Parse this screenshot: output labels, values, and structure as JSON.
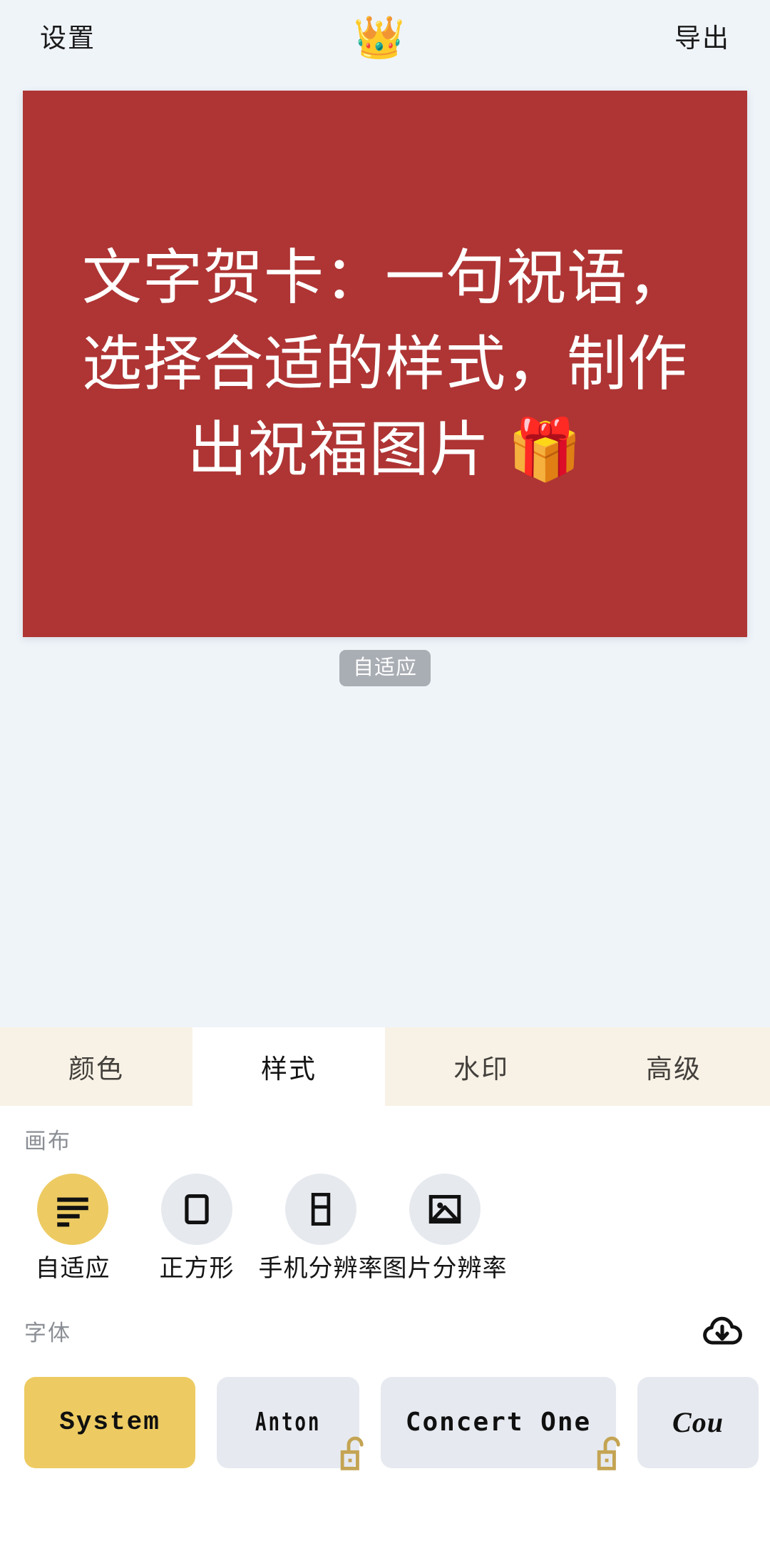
{
  "topbar": {
    "settings_label": "设置",
    "logo_icon": "crown-icon",
    "logo_glyph": "👑",
    "export_label": "导出"
  },
  "canvas": {
    "background_color": "#ae3534",
    "text_color": "#ffffff",
    "text": "文字贺卡：一句祝语，选择合适的样式，制作出祝福图片 🎁",
    "ratio_badge": "自适应"
  },
  "tabs": [
    {
      "label": "颜色",
      "active": false
    },
    {
      "label": "样式",
      "active": true
    },
    {
      "label": "水印",
      "active": false
    },
    {
      "label": "高级",
      "active": false
    }
  ],
  "canvas_section": {
    "label": "画布",
    "options": [
      {
        "label": "自适应",
        "icon": "align-left-icon",
        "selected": true
      },
      {
        "label": "正方形",
        "icon": "square-icon",
        "selected": false
      },
      {
        "label": "手机分辨率",
        "icon": "phone-icon",
        "selected": false
      },
      {
        "label": "图片分辨率",
        "icon": "image-icon",
        "selected": false
      }
    ]
  },
  "font_section": {
    "label": "字体",
    "download_icon": "cloud-download-icon",
    "fonts": [
      {
        "label": "System",
        "selected": true,
        "locked": false
      },
      {
        "label": "Anton",
        "selected": false,
        "locked": true
      },
      {
        "label": "Concert One",
        "selected": false,
        "locked": true
      },
      {
        "label": "Cou",
        "selected": false,
        "locked": true
      }
    ]
  },
  "colors": {
    "accent": "#edcb62",
    "canvas_red": "#ae3534",
    "page_background": "#eff4f9",
    "tab_inactive": "#f8f2e6",
    "tab_active": "#ffffff",
    "chip_idle": "#e6eaf0",
    "badge_grey": "#a9adb4",
    "lock_gold": "#c4a453"
  }
}
